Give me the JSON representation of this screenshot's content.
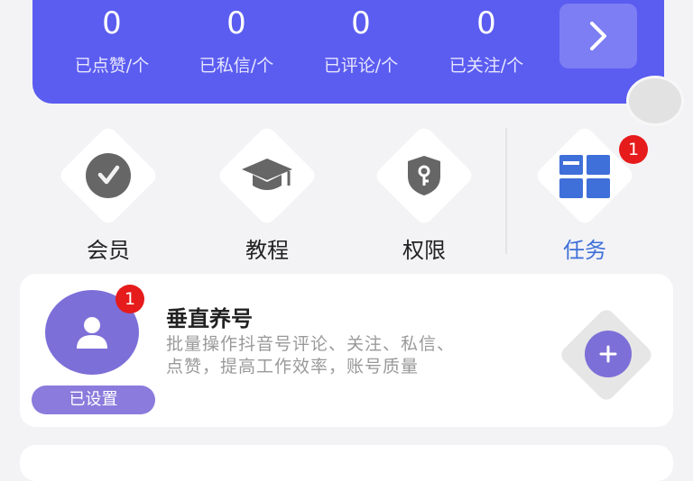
{
  "stats": [
    {
      "value": "0",
      "label": "已点赞/个"
    },
    {
      "value": "0",
      "label": "已私信/个"
    },
    {
      "value": "0",
      "label": "已评论/个"
    },
    {
      "value": "0",
      "label": "已关注/个"
    }
  ],
  "menu": [
    {
      "label": "会员",
      "icon": "vip-icon"
    },
    {
      "label": "教程",
      "icon": "graduation-cap-icon"
    },
    {
      "label": "权限",
      "icon": "shield-key-icon"
    },
    {
      "label": "任务",
      "icon": "tasks-grid-icon",
      "badge": "1"
    }
  ],
  "task": {
    "badge": "1",
    "title": "垂直养号",
    "desc_line1": "批量操作抖音号评论、关注、私信、",
    "desc_line2": "点赞，提高工作效率，账号质量",
    "status": "已设置"
  },
  "colors": {
    "primary": "#5b5cf0",
    "accent": "#7c6fd8",
    "badge": "#e61b1b",
    "task_blue": "#3f6fd8"
  }
}
